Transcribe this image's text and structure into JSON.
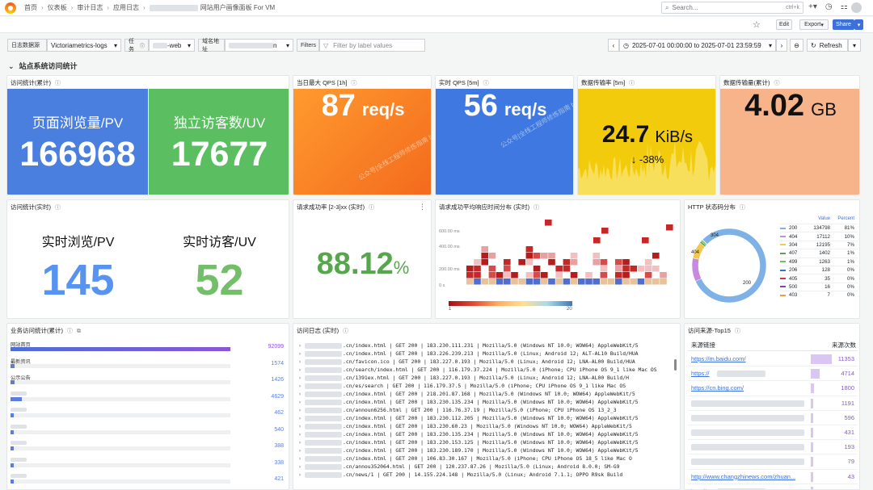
{
  "topbar": {
    "breadcrumbs": [
      "首页",
      "仪表板",
      "审计日志",
      "应用日志",
      "网站用户画像面板 For VM"
    ],
    "search_placeholder": "Search...",
    "search_shortcut": "ctrl+k"
  },
  "toolbar": {
    "edit": "Edit",
    "export": "Export",
    "share": "Share"
  },
  "variables": {
    "datasource_label": "日志数据源",
    "datasource_value": "Victoriametrics-logs",
    "job_label": "任务",
    "job_value": "-web",
    "domain_label": "域名地址",
    "domain_value": "n",
    "filters_label": "Filters",
    "filters_placeholder": "Filter by label values",
    "time_range": "2025-07-01 00:00:00 to 2025-07-01 23:59:59",
    "refresh": "Refresh"
  },
  "row_title": "站点系统访问统计",
  "panels": {
    "total_title": "访问统计(累计)",
    "pv_label": "页面浏览量/PV",
    "pv_value": "166968",
    "uv_label": "独立访客数/UV",
    "uv_value": "17677",
    "qps_title": "当日最大 QPS [1h]",
    "qps_value": "87",
    "qps_unit": "req/s",
    "rqps_title": "实时 QPS [5m]",
    "rqps_value": "56",
    "rqps_unit": "req/s",
    "rate_title": "数据传输率 [5m]",
    "rate_value": "24.7",
    "rate_unit": "KiB/s",
    "rate_delta": "-38%",
    "vol_title": "数据传输量(累计)",
    "vol_value": "4.02",
    "vol_unit": "GB",
    "rt_title": "访问统计(实时)",
    "rt_pv_label": "实时浏览/PV",
    "rt_pv_value": "145",
    "rt_uv_label": "实时访客/UV",
    "rt_uv_value": "52",
    "success_title": "请求成功率 [2-3]xx (实时)",
    "success_value": "88.12",
    "success_unit": "%",
    "heat_title": "请求成功平均响应时间分布 (实时)",
    "heat_legend_min": "1",
    "heat_legend_max": "20",
    "http_title": "HTTP 状态码分布",
    "biz_title": "业务访问统计(累计)",
    "log_title": "访问日志 (实时)",
    "top_title": "访问来源-Top15",
    "top_col_link": "来源链接",
    "top_col_count": "来源次数",
    "watermark": "公众号|全栈工程师修炼指南 blog.weiyigeek.top"
  },
  "heatmap_ticks": [
    "600.00 ms",
    "400.00 ms",
    "200.00 ms",
    "0 s"
  ],
  "http_legend": {
    "col_value": "Value",
    "col_percent": "Percent",
    "rows": [
      {
        "code": "200",
        "value": "134798",
        "percent": "81%",
        "color": "#7eb2e6"
      },
      {
        "code": "404",
        "value": "17112",
        "percent": "10%",
        "color": "#c88ae0"
      },
      {
        "code": "304",
        "value": "12195",
        "percent": "7%",
        "color": "#f2c94c"
      },
      {
        "code": "407",
        "value": "1402",
        "percent": "1%",
        "color": "#5aa454"
      },
      {
        "code": "499",
        "value": "1263",
        "percent": "1%",
        "color": "#73bf69"
      },
      {
        "code": "206",
        "value": "128",
        "percent": "0%",
        "color": "#3274d9"
      },
      {
        "code": "405",
        "value": "35",
        "percent": "0%",
        "color": "#e02f44"
      },
      {
        "code": "500",
        "value": "16",
        "percent": "0%",
        "color": "#8f3bb8"
      },
      {
        "code": "403",
        "value": "7",
        "percent": "0%",
        "color": "#ff9830"
      }
    ]
  },
  "http_pie_labels": [
    "304",
    "404",
    "200"
  ],
  "biz": [
    {
      "label": "网站首页",
      "value": "92099",
      "ratio": 1.0
    },
    {
      "label": "最新资讯",
      "value": "1574",
      "ratio": 0.02
    },
    {
      "label": "公示公告",
      "value": "1426",
      "ratio": 0.02
    },
    {
      "label": "",
      "value": "4629",
      "ratio": 0.05
    },
    {
      "label": "",
      "value": "462",
      "ratio": 0.01
    },
    {
      "label": "",
      "value": "540",
      "ratio": 0.01
    },
    {
      "label": "",
      "value": "388",
      "ratio": 0.01
    },
    {
      "label": "",
      "value": "338",
      "ratio": 0.01
    },
    {
      "label": "",
      "value": "421",
      "ratio": 0.01
    }
  ],
  "logs": [
    ".cn/index.html | GET 200 | 183.230.111.231 | Mozilla/5.0 (Windows NT 10.0; WOW64) AppleWebKit/5",
    ".cn/index.html | GET 200 | 183.226.239.213 | Mozilla/5.0 (Linux; Android 12; ALT-AL10 Build/HUA",
    ".cn/favicon.ico | GET 200 | 183.227.0.193 | Mozilla/5.0 (Linux; Android 12; LNA-AL00 Build/HUA",
    ".cn/search/index.html | GET 200 | 116.179.37.224 | Mozilla/5.0 (iPhone; CPU iPhone OS 9_1 like Mac OS",
    ".cn/1391ex.html | GET 200 | 183.227.0.193 | Mozilla/5.0 (Linux; Android 12; LNA-AL00 Build/H",
    ".cn/es/search | GET 200 | 116.179.37.5 | Mozilla/5.0 (iPhone; CPU iPhone OS 9_1 like Mac OS",
    ".cn/index.html | GET 200 | 218.201.87.168 | Mozilla/5.0 (Windows NT 10.0; WOW64) AppleWebKit/5",
    ".cn/index.html | GET 200 | 183.230.135.234 | Mozilla/5.0 (Windows NT 10.0; WOW64) AppleWebKit/5",
    ".cn/announ6256.html | GET 200 | 116.76.37.19 | Mozilla/5.0 (iPhone; CPU iPhone OS 13_2_3",
    ".cn/index.html | GET 200 | 183.230.112.205 | Mozilla/5.0 (Windows NT 10.0; WOW64) AppleWebKit/5",
    ".cn/index.html | GET 200 | 183.230.60.23 | Mozilla/5.0 (Windows NT 10.0; WOW64) AppleWebKit/5",
    ".cn/index.html | GET 200 | 183.230.135.234 | Mozilla/5.0 (Windows NT 10.0; WOW64) AppleWebKit/5",
    ".cn/index.html | GET 200 | 183.230.153.125 | Mozilla/5.0 (Windows NT 10.0; WOW64) AppleWebKit/5",
    ".cn/index.html | GET 200 | 183.230.189.170 | Mozilla/5.0 (Windows NT 10.0; WOW64) AppleWebKit/5",
    ".cn/index.html | GET 200 | 106.83.30.167 | Mozilla/5.0 (iPhone; CPU iPhone OS 18_5 like Mac O",
    ".cn/annou352064.html | GET 200 | 120.237.87.26 | Mozilla/5.0 (Linux; Android 8.0.0; SM-G9",
    ".cn/news/1 | GET 200 | 14.155.224.148 | Mozilla/5.0 (Linux; Android 7.1.1; OPPO R9sk Build"
  ],
  "top": [
    {
      "link": "https://m.baidu.com/",
      "count": "11353",
      "ratio": 1.0
    },
    {
      "link": "https://",
      "count": "4714",
      "ratio": 0.42
    },
    {
      "link": "https://cn.bing.com/",
      "count": "1800",
      "ratio": 0.16
    },
    {
      "link": "",
      "count": "1191",
      "ratio": 0.1
    },
    {
      "link": "",
      "count": "596",
      "ratio": 0.05
    },
    {
      "link": "",
      "count": "431",
      "ratio": 0.04
    },
    {
      "link": "",
      "count": "193",
      "ratio": 0.02
    },
    {
      "link": "",
      "count": "79",
      "ratio": 0.01
    },
    {
      "link": "http://www.changzhinews.com/zhuan...",
      "count": "43",
      "ratio": 0.01
    },
    {
      "link": "http://",
      "count": "41",
      "ratio": 0.01
    }
  ]
}
